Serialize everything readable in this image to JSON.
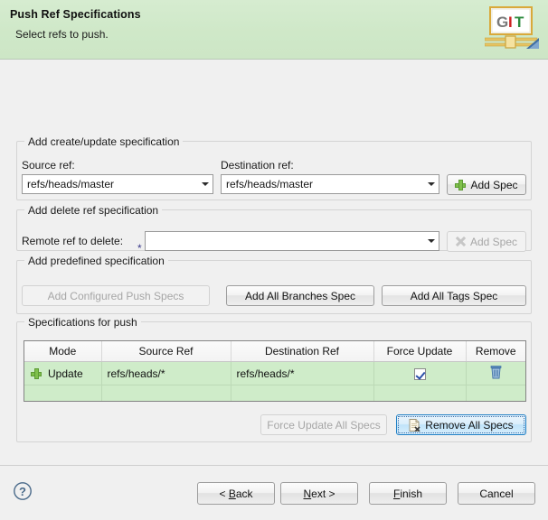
{
  "header": {
    "title": "Push Ref Specifications",
    "subtitle": "Select refs to push.",
    "logo_text": "GIT",
    "logo_colors": {
      "g": "#7a7a7a",
      "i": "#cc2222",
      "t": "#2e8b3f"
    },
    "background": "#cfe8c8"
  },
  "create_update_group": {
    "title": "Add create/update specification",
    "source_label": "Source ref:",
    "source_value": "refs/heads/master",
    "destination_label": "Destination ref:",
    "destination_value": "refs/heads/master",
    "add_spec_label": "Add Spec"
  },
  "delete_group": {
    "title": "Add delete ref specification",
    "remote_label": "Remote ref to delete:",
    "required_marker": "*",
    "remote_value": "",
    "remote_placeholder": "",
    "add_spec_label": "Add Spec",
    "add_spec_disabled": true
  },
  "predefined_group": {
    "title": "Add predefined specification",
    "buttons": [
      {
        "label": "Add Configured Push Specs",
        "disabled": true
      },
      {
        "label": "Add All Branches Spec",
        "disabled": false
      },
      {
        "label": "Add All Tags Spec",
        "disabled": false
      }
    ]
  },
  "specs_group": {
    "title": "Specifications for push",
    "columns": [
      "Mode",
      "Source Ref",
      "Destination Ref",
      "Force Update",
      "Remove"
    ],
    "rows": [
      {
        "mode_icon": "plus-icon",
        "mode": "Update",
        "source_ref": "refs/heads/*",
        "destination_ref": "refs/heads/*",
        "force_update": true,
        "remove_icon": "trash-icon"
      },
      {
        "mode_icon": "",
        "mode": "",
        "source_ref": "",
        "destination_ref": "",
        "force_update": null,
        "remove_icon": ""
      }
    ],
    "row_background": "#cfecc9",
    "force_update_all_label": "Force Update All Specs",
    "force_update_all_disabled": true,
    "remove_all_label": "Remove All Specs",
    "remove_all_focused": true
  },
  "footer": {
    "help_icon": "help-question-icon",
    "buttons": [
      {
        "label": "< Back",
        "mnemonic": "B"
      },
      {
        "label": "Next >",
        "mnemonic": "N"
      },
      {
        "label": "Finish",
        "mnemonic": "F"
      },
      {
        "label": "Cancel",
        "mnemonic": ""
      }
    ]
  }
}
